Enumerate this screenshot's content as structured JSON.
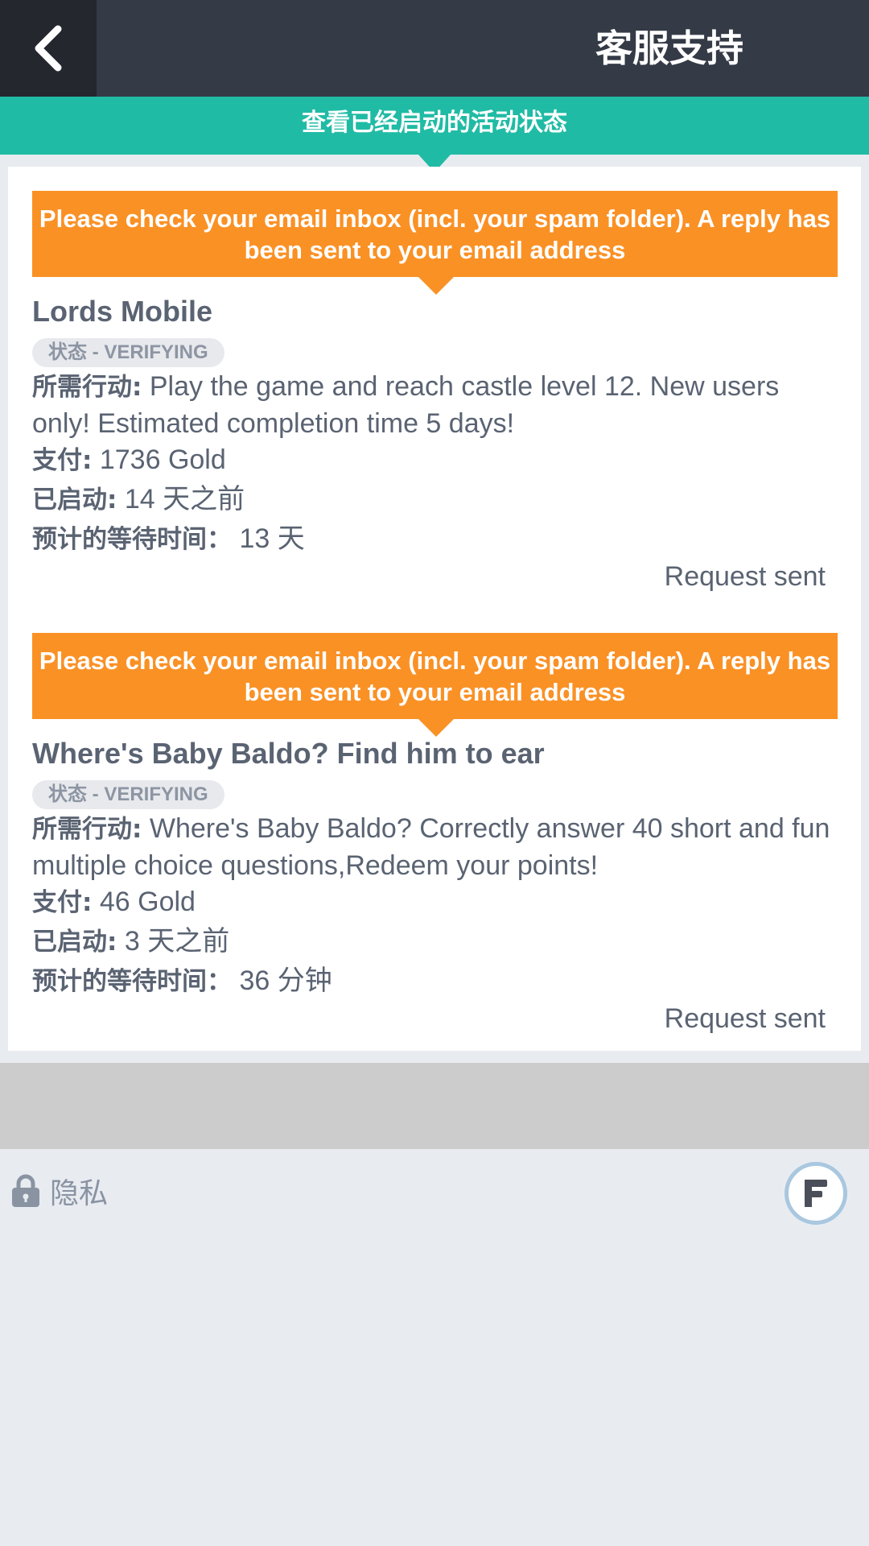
{
  "header": {
    "title": "客服支持",
    "back_icon": "chevron-left-icon"
  },
  "subbar": {
    "label": "查看已经启动的活动状态"
  },
  "offers": [
    {
      "notice": "Please check your email inbox (incl. your spam folder). A reply has been sent to your email address",
      "title": "Lords Mobile",
      "status": "状态 - VERIFYING",
      "action_label": "所需行动:",
      "action_text": "Play the game and reach castle level 12. New users only! Estimated completion time 5 days!",
      "pay_label": "支付:",
      "pay_value": "1736 Gold",
      "started_label": "已启动:",
      "started_value": "14 天之前",
      "wait_label": "预计的等待时间：",
      "wait_value": "13 天",
      "request_status": "Request sent"
    },
    {
      "notice": "Please check your email inbox (incl. your spam folder). A reply has been sent to your email address",
      "title": "Where's Baby Baldo? Find him to ear",
      "status": "状态 - VERIFYING",
      "action_label": "所需行动:",
      "action_text": "Where's Baby Baldo? Correctly answer 40 short and fun multiple choice questions,Redeem your points!",
      "pay_label": "支付:",
      "pay_value": "46 Gold",
      "started_label": "已启动:",
      "started_value": "3 天之前",
      "wait_label": "预计的等待时间：",
      "wait_value": "36 分钟",
      "request_status": "Request sent"
    }
  ],
  "footer": {
    "privacy_label": "隐私",
    "privacy_icon": "lock-icon",
    "brand_icon": "brand-f-icon"
  },
  "colors": {
    "header_bg": "#343a46",
    "back_bg": "#24272e",
    "accent_teal": "#20bba5",
    "notice_orange": "#fa9125",
    "text": "#5a6372",
    "page_bg": "#e8ecf1"
  }
}
